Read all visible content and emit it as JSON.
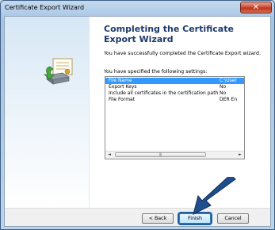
{
  "window": {
    "title": "Certificate Export Wizard",
    "close_glyph": "✕"
  },
  "heading": "Completing the Certificate Export Wizard",
  "intro": "You have successfully completed the Certificate Export wizard.",
  "settings_label": "You have specified the following settings:",
  "settings": [
    {
      "key": "File Name",
      "value": "C:\\User"
    },
    {
      "key": "Export Keys",
      "value": "No"
    },
    {
      "key": "Include all certificates in the certification path",
      "value": "No"
    },
    {
      "key": "File Format",
      "value": "DER En"
    }
  ],
  "scrollbar": {
    "left_arrow": "◄",
    "right_arrow": "►",
    "thumb_grip": "|||"
  },
  "buttons": {
    "back": "< Back",
    "finish": "Finish",
    "cancel": "Cancel"
  },
  "colors": {
    "accent": "#1f4e8c",
    "selection": "#3399ff"
  },
  "icons": {
    "wizard": "certificate-icon",
    "annotation": "arrow-icon"
  }
}
